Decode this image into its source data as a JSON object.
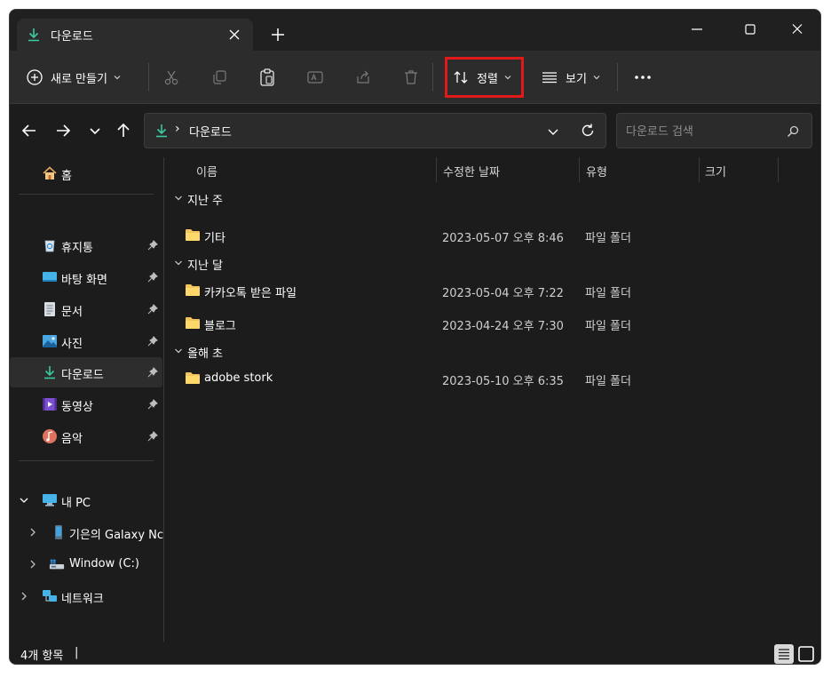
{
  "tab": {
    "title": "다운로드",
    "icon": "download-icon"
  },
  "window_controls": [
    "minimize-icon",
    "maximize-icon",
    "close-icon"
  ],
  "toolbar": {
    "new_label": "새로 만들기",
    "sort_label": "정렬",
    "view_label": "보기",
    "actions": [
      "cut-icon",
      "copy-icon",
      "paste-icon",
      "rename-icon",
      "share-icon",
      "delete-icon",
      "more-icon"
    ]
  },
  "address": {
    "path_label": "다운로드",
    "separator": "›"
  },
  "search": {
    "placeholder": "다운로드 검색"
  },
  "sidebar": {
    "home": "홈",
    "quick": [
      {
        "label": "휴지통",
        "icon": "recycle-bin-icon"
      },
      {
        "label": "바탕 화면",
        "icon": "desktop-icon"
      },
      {
        "label": "문서",
        "icon": "document-icon"
      },
      {
        "label": "사진",
        "icon": "pictures-icon"
      },
      {
        "label": "다운로드",
        "icon": "download-icon"
      },
      {
        "label": "동영상",
        "icon": "videos-icon"
      },
      {
        "label": "음악",
        "icon": "music-icon"
      }
    ],
    "this_pc": "내 PC",
    "devices": [
      {
        "label": "기은의 Galaxy Nc",
        "icon": "phone-icon"
      },
      {
        "label": "Window (C:)",
        "icon": "drive-icon"
      }
    ],
    "network": "네트워크"
  },
  "columns": {
    "name": "이름",
    "date": "수정한 날짜",
    "type": "유형",
    "size": "크기"
  },
  "groups": [
    {
      "label": "지난 주",
      "items": [
        {
          "name": "기타",
          "date": "2023-05-07 오후 8:46",
          "type": "파일 폴더"
        }
      ]
    },
    {
      "label": "지난 달",
      "items": [
        {
          "name": "카카오톡 받은 파일",
          "date": "2023-05-04 오후 7:22",
          "type": "파일 폴더"
        },
        {
          "name": "블로그",
          "date": "2023-04-24 오후 7:30",
          "type": "파일 폴더"
        }
      ]
    },
    {
      "label": "올해 초",
      "items": [
        {
          "name": "adobe stork",
          "date": "2023-05-10 오후 6:35",
          "type": "파일 폴더"
        }
      ]
    }
  ],
  "status": {
    "count_text": "4개 항목",
    "separator": "|"
  },
  "colors": {
    "highlight": "#e0191b",
    "download_accent": "#3cc8a0",
    "folder": "#f2c55c"
  }
}
